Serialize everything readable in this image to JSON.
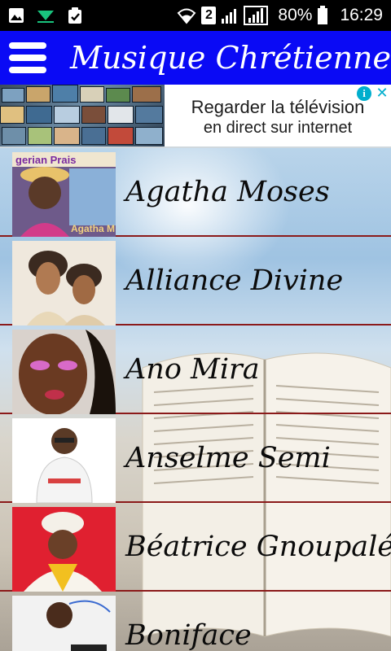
{
  "status_bar": {
    "icons_left": [
      "image-icon",
      "download-icon",
      "clipboard-check-icon"
    ],
    "sim": "2",
    "battery": "80%",
    "time": "16:29"
  },
  "app_bar": {
    "title": "Musique Chrétienne"
  },
  "ad": {
    "line1": "Regarder la télévision",
    "line2": "en direct sur internet",
    "accent": "#00aecd"
  },
  "list": {
    "items": [
      {
        "name": "Agatha Moses",
        "thumb_caption_top": "gerian Prais",
        "thumb_caption_bottom": "Agatha M"
      },
      {
        "name": "Alliance Divine"
      },
      {
        "name": "Ano Mira"
      },
      {
        "name": "Anselme Semi"
      },
      {
        "name": "Béatrice Gnoupalé"
      },
      {
        "name": "Boniface"
      }
    ]
  },
  "colors": {
    "app_bar": "#0a0af5",
    "divider": "#8b1a1a"
  }
}
